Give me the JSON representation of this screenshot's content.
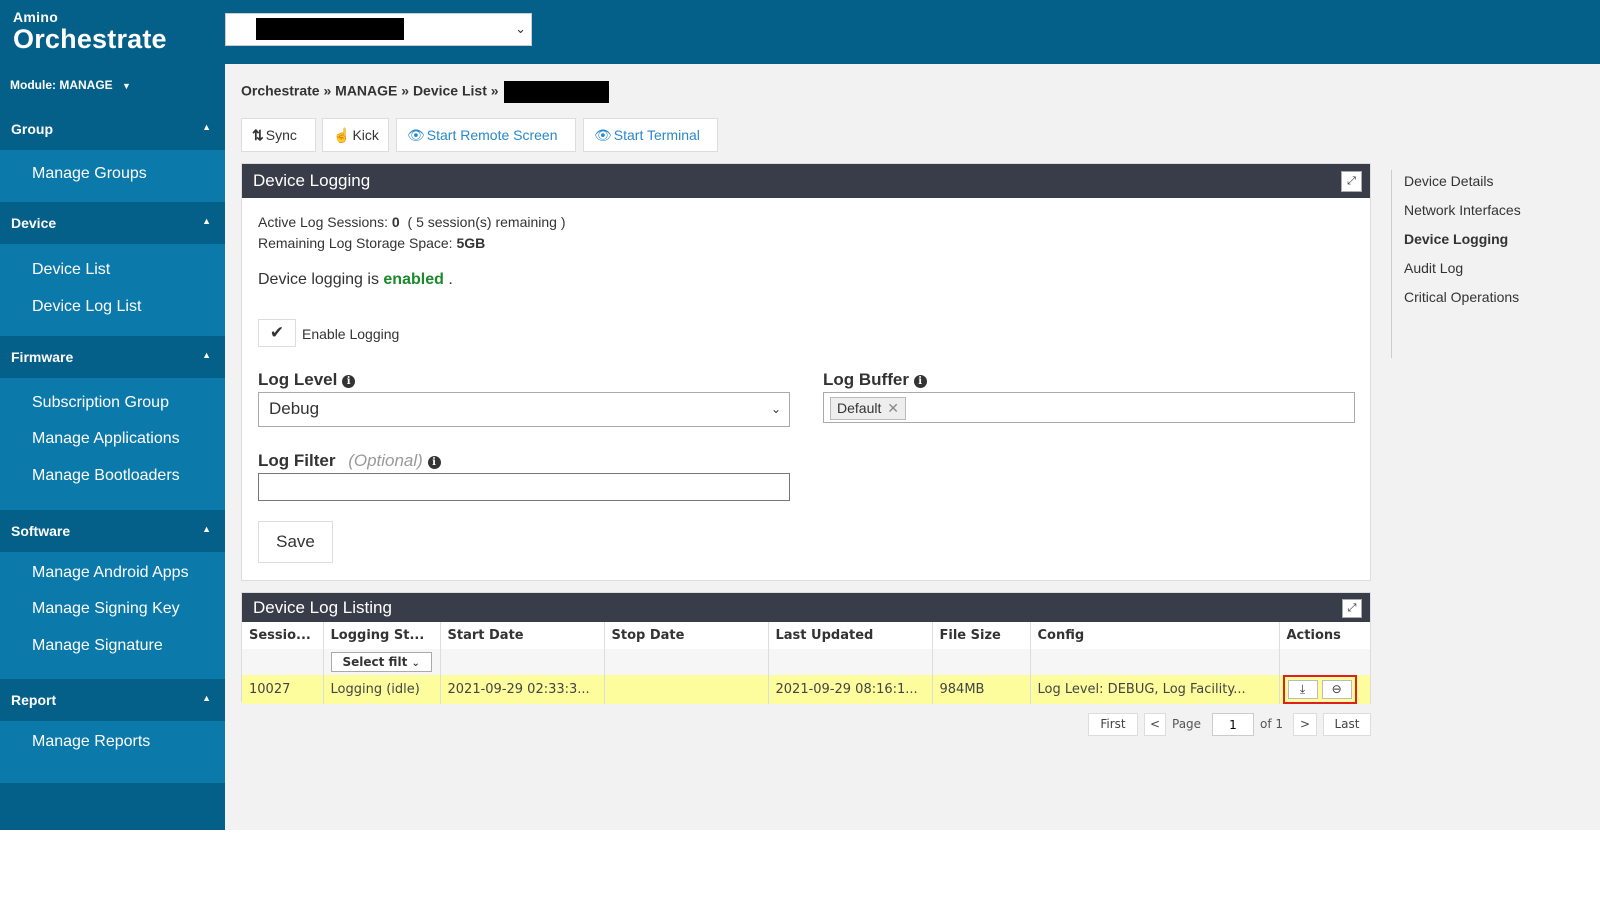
{
  "header": {
    "brand_small": "Amino",
    "brand_big": "Orchestrate"
  },
  "sidebar": {
    "module_label": "Module: MANAGE",
    "sections": [
      {
        "title": "Group",
        "items": [
          "Manage Groups"
        ]
      },
      {
        "title": "Device",
        "items": [
          "Device List",
          "Device Log List"
        ]
      },
      {
        "title": "Firmware",
        "items": [
          "Subscription Group",
          "Manage Applications",
          "Manage Bootloaders"
        ]
      },
      {
        "title": "Software",
        "items": [
          "Manage Android Apps",
          "Manage Signing Key",
          "Manage Signature"
        ]
      },
      {
        "title": "Report",
        "items": [
          "Manage Reports"
        ]
      }
    ]
  },
  "breadcrumb": "Orchestrate » MANAGE » Device List »",
  "toolbar": {
    "sync": "Sync",
    "kick": "Kick",
    "remote_screen": "Start Remote Screen",
    "terminal": "Start Terminal"
  },
  "logging_panel": {
    "title": "Device Logging",
    "active_sessions_label": "Active Log Sessions:",
    "active_sessions_value": "0",
    "sessions_remaining": "( 5 session(s) remaining )",
    "storage_label": "Remaining Log Storage Space:",
    "storage_value": "5GB",
    "status_prefix": "Device logging is",
    "status_value": "enabled",
    "status_suffix": ".",
    "enable_logging_label": "Enable Logging",
    "enable_logging_checked": true,
    "log_level_label": "Log Level",
    "log_level_value": "Debug",
    "log_buffer_label": "Log Buffer",
    "log_buffer_tag": "Default",
    "log_filter_label": "Log Filter",
    "log_filter_optional": "(Optional)",
    "log_filter_value": "",
    "save_label": "Save"
  },
  "listing_panel": {
    "title": "Device Log Listing",
    "columns": [
      "Sessio...",
      "Logging St...",
      "Start Date",
      "Stop Date",
      "Last Updated",
      "File Size",
      "Config",
      "Actions"
    ],
    "filter_placeholder": "Select filt",
    "rows": [
      {
        "session": "10027",
        "logging_status": "Logging (idle)",
        "start_date": "2021-09-29 02:33:3...",
        "stop_date": "",
        "last_updated": "2021-09-29 08:16:1...",
        "file_size": "984MB",
        "config": "Log Level: DEBUG, Log Facility..."
      }
    ],
    "pager": {
      "first": "First",
      "prev": "<",
      "page_label": "Page",
      "page_value": "1",
      "of_label": "of 1",
      "next": ">",
      "last": "Last"
    }
  },
  "right_nav": {
    "items": [
      "Device Details",
      "Network Interfaces",
      "Device Logging",
      "Audit Log",
      "Critical Operations"
    ],
    "active": "Device Logging"
  },
  "colors": {
    "header_bg": "#046088",
    "sidebar_bg": "#0c79ab",
    "panel_head_bg": "#393c49",
    "row_highlight": "#fdfd9e",
    "enabled_green": "#1a8a2a",
    "link_blue": "#2a88c9"
  }
}
